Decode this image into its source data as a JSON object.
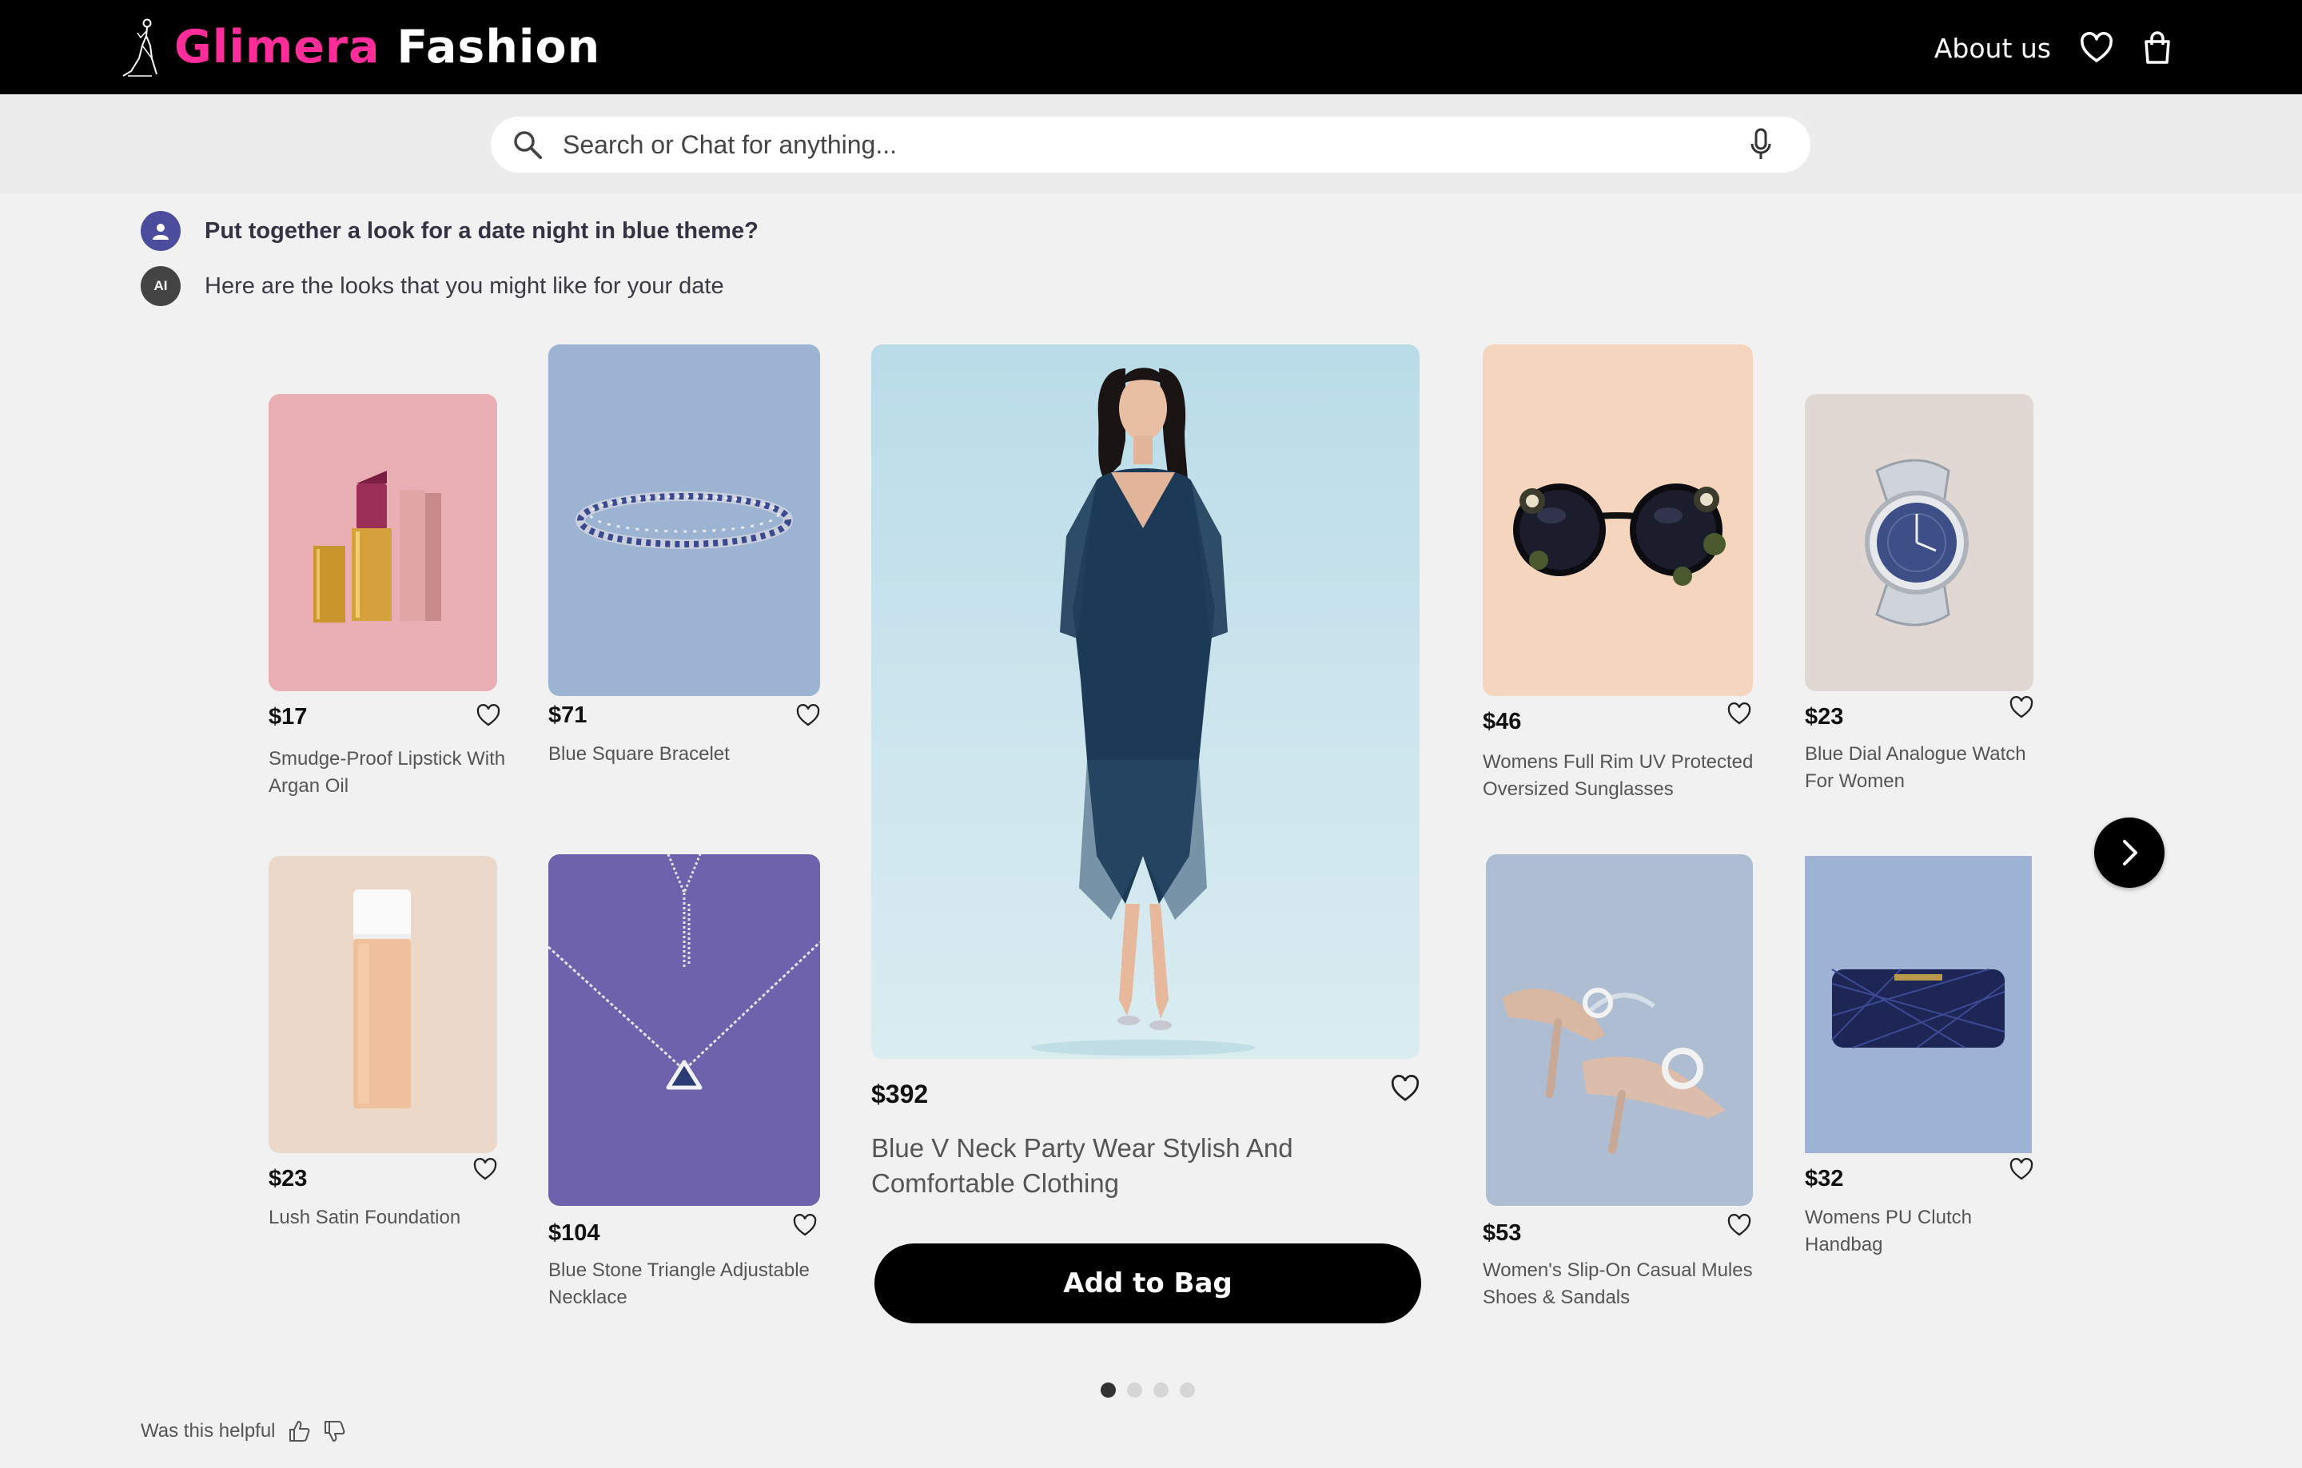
{
  "brand": {
    "part1": "Glimera",
    "part2": "Fashion",
    "accent": "#ff2d9a"
  },
  "nav": {
    "about": "About us",
    "wishlist_icon": "heart-icon",
    "bag_icon": "shopping-bag-icon"
  },
  "search": {
    "placeholder": "Search or Chat for anything...",
    "value": ""
  },
  "chat": {
    "question": "Put together a look for a date night in blue theme?",
    "answer": "Here are the looks that you might like for your date",
    "ai_badge": "AI"
  },
  "products": {
    "lipstick": {
      "price": "$17",
      "name": "Smudge-Proof Lipstick With Argan Oil"
    },
    "bracelet": {
      "price": "$71",
      "name": "Blue Square Bracelet"
    },
    "dress": {
      "price": "$392",
      "name": "Blue V Neck Party Wear Stylish And Comfortable Clothing"
    },
    "sunglasses": {
      "price": "$46",
      "name": "Womens Full Rim UV Protected Oversized Sunglasses"
    },
    "watch": {
      "price": "$23",
      "name": "Blue Dial Analogue Watch For Women"
    },
    "foundation": {
      "price": "$23",
      "name": "Lush Satin Foundation"
    },
    "necklace": {
      "price": "$104",
      "name": "Blue Stone Triangle Adjustable Necklace"
    },
    "shoes": {
      "price": "$53",
      "name": "Women's Slip-On Casual Mules Shoes & Sandals"
    },
    "clutch": {
      "price": "$32",
      "name": "Womens PU Clutch Handbag"
    }
  },
  "actions": {
    "add_to_bag": "Add to Bag"
  },
  "pagination": {
    "total": 4,
    "current": 1
  },
  "feedback": {
    "label": "Was this helpful"
  }
}
